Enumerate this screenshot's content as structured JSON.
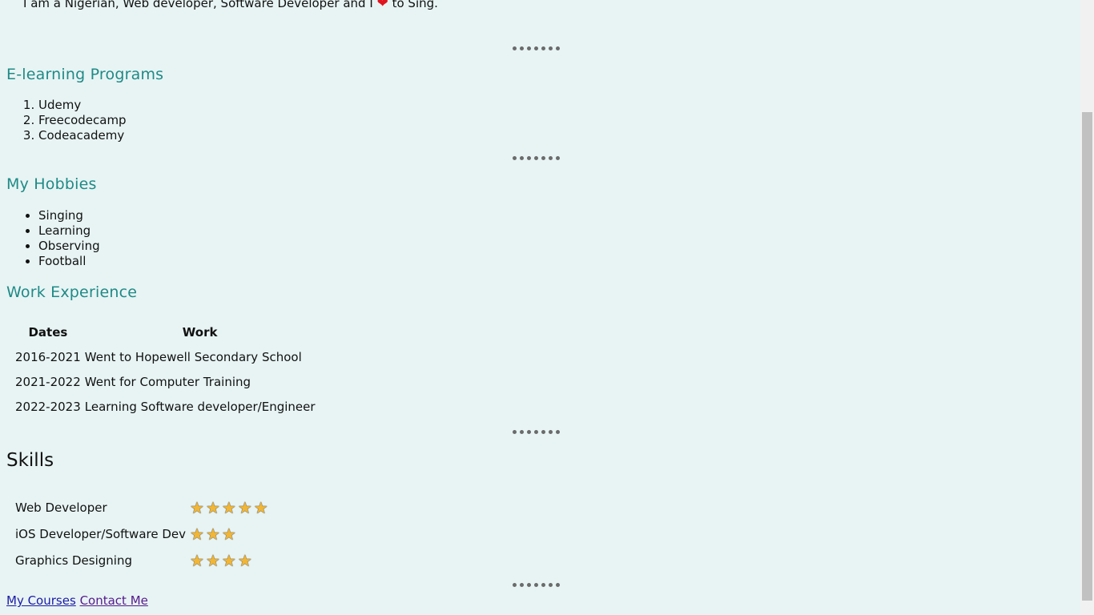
{
  "intro": {
    "before": "I am a Nigerian, Web developer, Software Developer and I",
    "heart": "❤",
    "after": "to Sing."
  },
  "elearning": {
    "title": "E-learning Programs",
    "items": [
      "Udemy",
      "Freecodecamp",
      "Codeacademy"
    ]
  },
  "hobbies": {
    "title": "My Hobbies",
    "items": [
      "Singing",
      "Learning",
      "Observing",
      "Football"
    ]
  },
  "work": {
    "title": "Work Experience",
    "headers": {
      "dates": "Dates",
      "work": "Work"
    },
    "rows": [
      {
        "dates": "2016-2021",
        "work": "Went to Hopewell Secondary School"
      },
      {
        "dates": "2021-2022",
        "work": "Went for Computer Training"
      },
      {
        "dates": "2022-2023",
        "work": "Learning Software developer/Engineer"
      }
    ]
  },
  "skills": {
    "title": "Skills",
    "rows": [
      {
        "name": "Web Developer",
        "stars": 5
      },
      {
        "name": "iOS Developer/Software Dev",
        "stars": 3
      },
      {
        "name": "Graphics Designing",
        "stars": 4
      }
    ]
  },
  "links": {
    "courses": "My Courses",
    "contact": "Contact Me"
  },
  "colors": {
    "background": "#e8f4f4",
    "heading": "#1f8a86",
    "star": "#f2b634",
    "heart": "#e0141e"
  }
}
